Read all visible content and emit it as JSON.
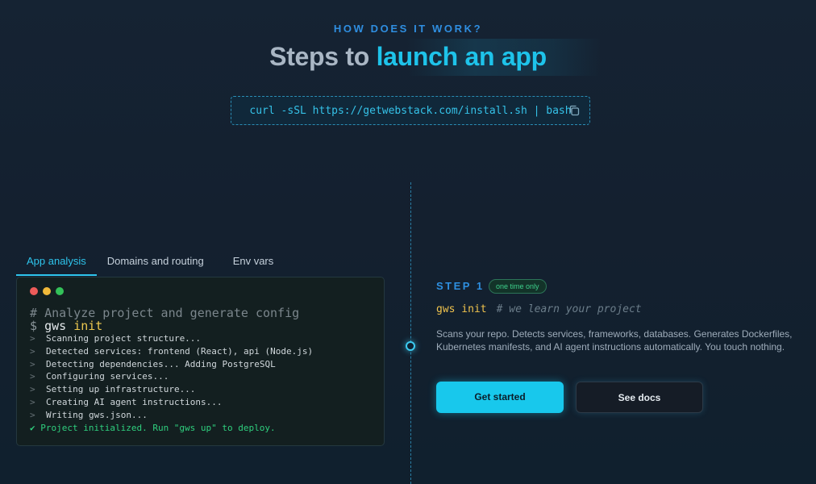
{
  "section": {
    "eyebrow": "HOW DOES IT WORK?",
    "title_plain": "Steps to",
    "title_accent": "launch an app"
  },
  "install": {
    "command": "curl -sSL https://getwebstack.com/install.sh | bash",
    "copy_icon": "copy-icon"
  },
  "tabs": [
    {
      "label": "App analysis",
      "active": true
    },
    {
      "label": "Domains and routing",
      "active": false
    },
    {
      "label": "Env vars",
      "active": false
    }
  ],
  "terminal": {
    "comment_prefix": "#",
    "comment": "Analyze project and generate config",
    "prompt": "$",
    "command": "gws",
    "command_arg": "init",
    "output_prefix": ">",
    "output": [
      "Scanning project structure...",
      "Detected services: frontend (React), api (Node.js)",
      "Detecting dependencies... Adding PostgreSQL",
      "Configuring services...",
      "Setting up infrastructure...",
      "Creating AI agent instructions...",
      "Writing gws.json..."
    ],
    "success": "✔ Project initialized. Run \"gws up\" to deploy."
  },
  "step": {
    "label": "STEP 1",
    "badge": "one time only",
    "command": "gws init",
    "command_comment": "# we learn your project",
    "description": "Scans your repo. Detects services, frameworks, databases. Generates Dockerfiles, Kubernetes manifests, and AI agent instructions automatically. You touch nothing.",
    "primary_button": "Get started",
    "secondary_button": "See docs"
  },
  "colors": {
    "accent": "#1ec3ea",
    "eyebrow": "#2f8ee0",
    "success": "#2fcf7e",
    "keyword": "#ecc84f"
  }
}
